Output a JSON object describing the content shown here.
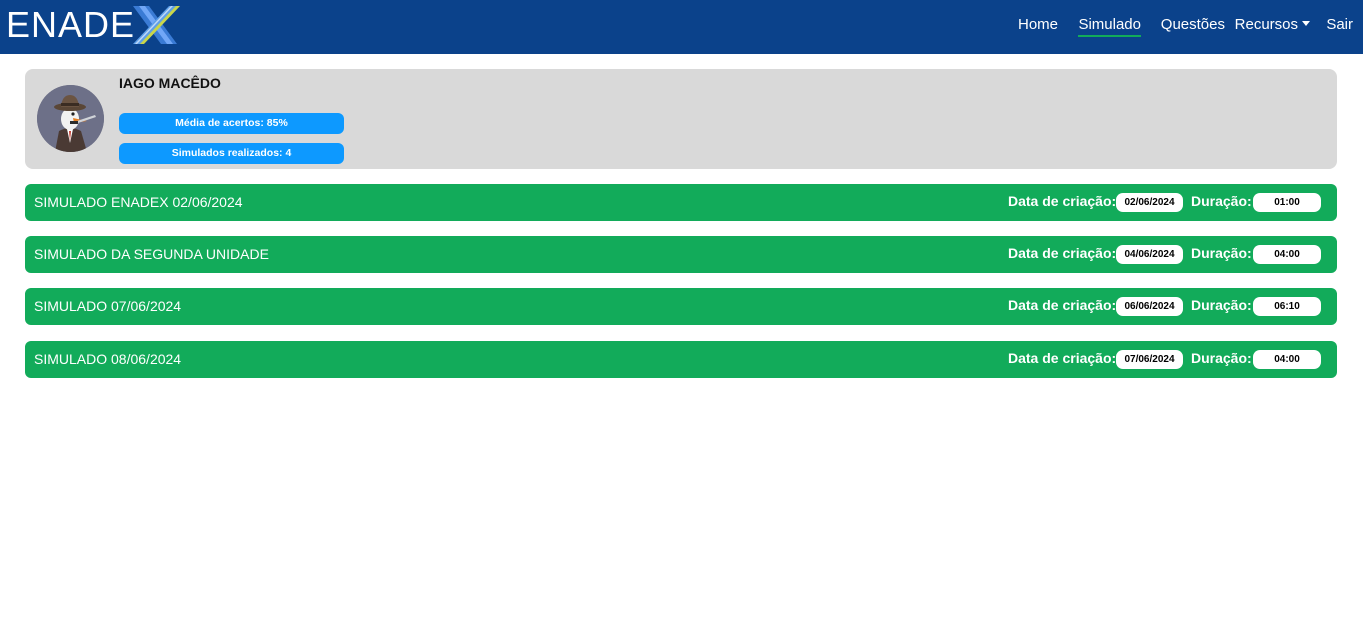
{
  "brand": {
    "logo_text": "ENADE"
  },
  "nav": {
    "home": "Home",
    "simulado": "Simulado",
    "questoes": "Questões",
    "recursos": "Recursos",
    "sair": "Sair"
  },
  "profile": {
    "name": "IAGO MACÊDO",
    "media_label": "Média de acertos: 85%",
    "simulados_label": "Simulados realizados: 4"
  },
  "labels": {
    "data_criacao": "Data de criação:",
    "duracao": "Duração:"
  },
  "simulados": [
    {
      "title": "SIMULADO ENADEX 02/06/2024",
      "data": "02/06/2024",
      "duracao": "01:00"
    },
    {
      "title": "SIMULADO DA SEGUNDA UNIDADE",
      "data": "04/06/2024",
      "duracao": "04:00"
    },
    {
      "title": "SIMULADO 07/06/2024",
      "data": "06/06/2024",
      "duracao": "06:10"
    },
    {
      "title": "SIMULADO 08/06/2024",
      "data": "07/06/2024",
      "duracao": "04:00"
    }
  ],
  "colors": {
    "navbar": "#0b428b",
    "row_green": "#12ab5a",
    "pill_blue": "#0d99ff",
    "card_gray": "#d9d9d9"
  }
}
